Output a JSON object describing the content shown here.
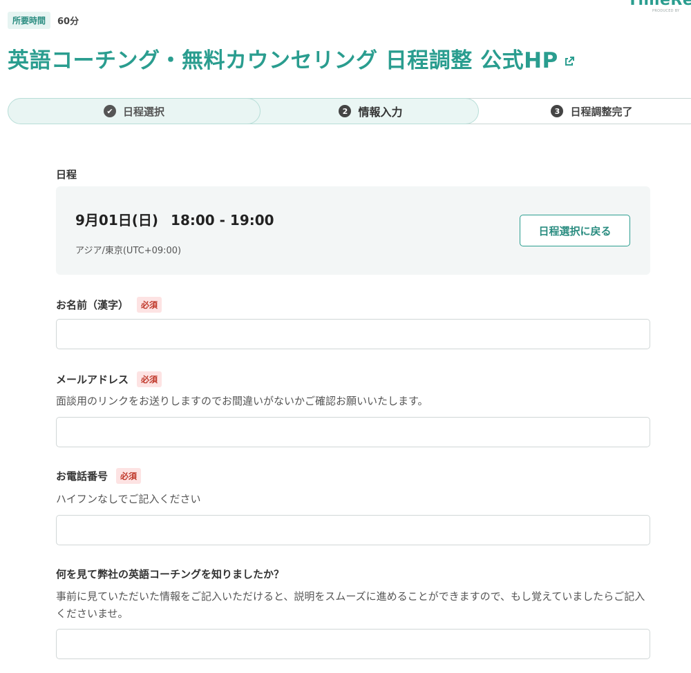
{
  "brand": {
    "logo_text": "TimeRex",
    "logo_sub": "PRODUCED BY"
  },
  "meta": {
    "duration_label": "所要時間",
    "duration_value": "60分"
  },
  "page_title": "英語コーチング・無料カウンセリング 日程調整 公式HP",
  "steps": [
    {
      "num": "✔",
      "label": "日程選択",
      "state": "done"
    },
    {
      "num": "2",
      "label": "情報入力",
      "state": "current"
    },
    {
      "num": "3",
      "label": "日程調整完了",
      "state": "upcoming"
    }
  ],
  "schedule": {
    "label": "日程",
    "date": "9月01日(日)",
    "time": "18:00 - 19:00",
    "timezone": "アジア/東京(UTC+09:00)",
    "back_button": "日程選択に戻る"
  },
  "form": {
    "required_badge": "必須",
    "name": {
      "label": "お名前（漢字）",
      "value": "",
      "placeholder": ""
    },
    "email": {
      "label": "メールアドレス",
      "help": "面談用のリンクをお送りしますのでお間違いがないかご確認お願いいたします。",
      "value": "",
      "placeholder": ""
    },
    "phone": {
      "label": "お電話番号",
      "help": "ハイフンなしでご記入ください",
      "value": "",
      "placeholder": ""
    },
    "source": {
      "label": "何を見て弊社の英語コーチングを知りましたか？",
      "help": "事前に見ていただいた情報をご記入いただけると、説明をスムーズに進めることができますので、もし覚えていましたらご記入くださいませ。",
      "value": "",
      "placeholder": ""
    }
  },
  "colors": {
    "accent": "#2a9d8f",
    "required": "#c0392b",
    "card_bg": "#f3f6f6"
  }
}
